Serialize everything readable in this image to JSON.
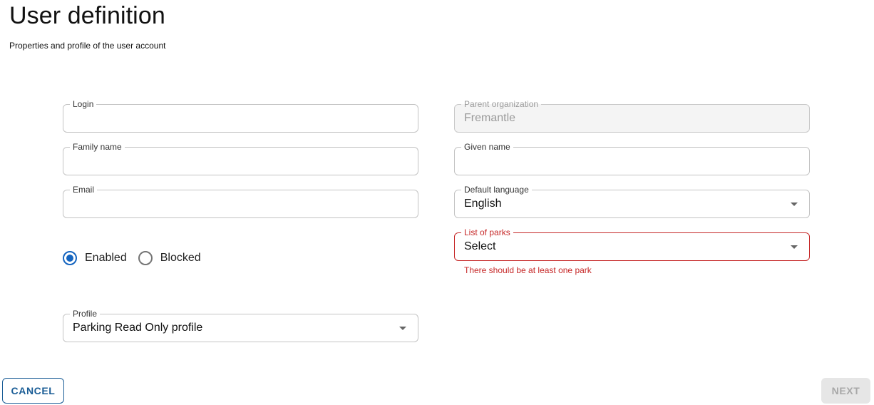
{
  "header": {
    "title": "User definition",
    "subtitle": "Properties and profile of the user account"
  },
  "form": {
    "login": {
      "label": "Login",
      "value": ""
    },
    "parent_organization": {
      "label": "Parent organization",
      "value": "Fremantle"
    },
    "family_name": {
      "label": "Family name",
      "value": ""
    },
    "given_name": {
      "label": "Given name",
      "value": ""
    },
    "email": {
      "label": "Email",
      "value": ""
    },
    "default_language": {
      "label": "Default language",
      "value": "English"
    },
    "list_of_parks": {
      "label": "List of parks",
      "value": "Select",
      "error": "There should be at least one park"
    },
    "status": {
      "options": [
        {
          "label": "Enabled",
          "checked": true
        },
        {
          "label": "Blocked",
          "checked": false
        }
      ]
    },
    "profile": {
      "label": "Profile",
      "value": "Parking Read Only profile"
    }
  },
  "actions": {
    "cancel_label": "CANCEL",
    "next_label": "NEXT"
  },
  "colors": {
    "accent": "#1565c0",
    "error": "#c62828",
    "cancel_border": "#1a5d96",
    "disabled_bg": "#f4f4f4"
  },
  "icons": {
    "dropdown": "caret-down-icon",
    "radio_checked": "radio-checked-icon",
    "radio_unchecked": "radio-unchecked-icon"
  }
}
